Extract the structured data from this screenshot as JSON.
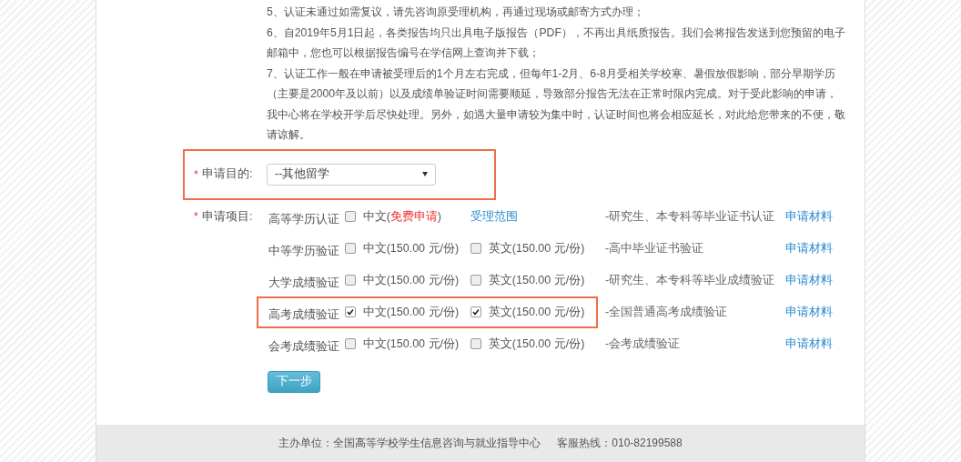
{
  "notes": [
    "5、认证未通过如需复议，请先咨询原受理机构，再通过现场或邮寄方式办理；",
    "6、自2019年5月1日起，各类报告均只出具电子版报告（PDF），不再出具纸质报告。我们会将报告发送到您预留的电子邮箱中，您也可以根据报告编号在学信网上查询并下载；",
    "7、认证工作一般在申请被受理后的1个月左右完成，但每年1-2月、6-8月受相关学校寒、暑假放假影响，部分早期学历（主要是2000年及以前）以及成绩单验证时间需要顺延，导致部分报告无法在正常时限内完成。对于受此影响的申请，我中心将在学校开学后尽快处理。另外，如遇大量申请较为集中时，认证时间也将会相应延长，对此给您带来的不便，敬请谅解。"
  ],
  "purpose": {
    "required_mark": "*",
    "label": "申请目的:",
    "value": "--其他留学",
    "highlighted": true
  },
  "items": {
    "required_mark": "*",
    "label": "申请项目:",
    "rows": [
      {
        "name": "高等学历认证",
        "highlighted": false,
        "options": [
          {
            "kind": "checkbox",
            "label": "中文(",
            "note": "免费申请",
            "suffix": ")",
            "checked": false
          },
          {
            "kind": "link",
            "label": "受理范围"
          }
        ],
        "description": "-研究生、本专科等毕业证书认证",
        "link": "申请材料"
      },
      {
        "name": "中等学历验证",
        "highlighted": false,
        "options": [
          {
            "kind": "checkbox",
            "label": "中文(150.00 元/份)",
            "checked": false
          },
          {
            "kind": "checkbox",
            "label": "英文(150.00 元/份)",
            "checked": false
          }
        ],
        "description": "-高中毕业证书验证",
        "link": "申请材料"
      },
      {
        "name": "大学成绩验证",
        "highlighted": false,
        "options": [
          {
            "kind": "checkbox",
            "label": "中文(150.00 元/份)",
            "checked": false
          },
          {
            "kind": "checkbox",
            "label": "英文(150.00 元/份)",
            "checked": false
          }
        ],
        "description": "-研究生、本专科等毕业成绩验证",
        "link": "申请材料"
      },
      {
        "name": "高考成绩验证",
        "highlighted": true,
        "options": [
          {
            "kind": "checkbox",
            "label": "中文(150.00 元/份)",
            "checked": true
          },
          {
            "kind": "checkbox",
            "label": "英文(150.00 元/份)",
            "checked": true
          }
        ],
        "description": "-全国普通高考成绩验证",
        "link": "申请材料"
      },
      {
        "name": "会考成绩验证",
        "highlighted": false,
        "options": [
          {
            "kind": "checkbox",
            "label": "中文(150.00 元/份)",
            "checked": false
          },
          {
            "kind": "checkbox",
            "label": "英文(150.00 元/份)",
            "checked": false
          }
        ],
        "description": "-会考成绩验证",
        "link": "申请材料"
      }
    ]
  },
  "next_button": "下一步",
  "footer": {
    "organizer": "主办单位：全国高等学校学生信息咨询与就业指导中心",
    "hotline": "客服热线：010-82199588"
  }
}
